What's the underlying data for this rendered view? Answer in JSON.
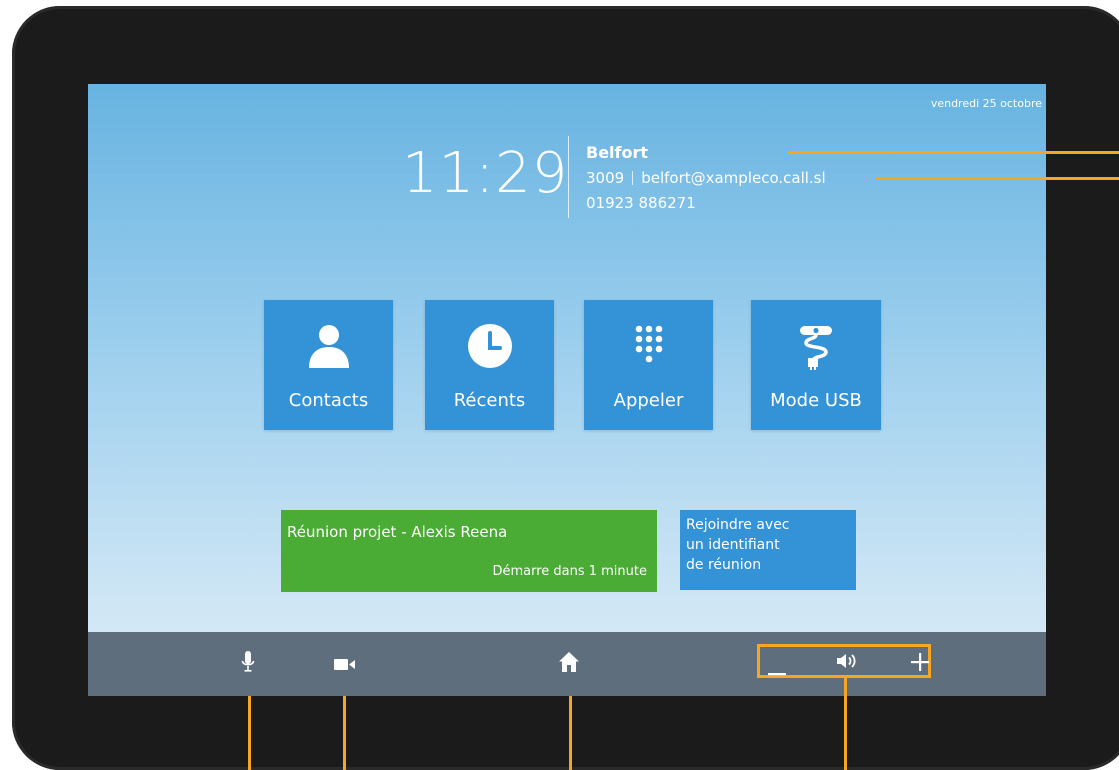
{
  "status": {
    "date": "vendredi 25 octobre",
    "time": "11:29"
  },
  "device_info": {
    "name": "Belfort",
    "extension": "3009",
    "email": "belfort@xampleco.call.sl",
    "phone": "01923 886271"
  },
  "tiles": [
    {
      "label": "Contacts",
      "icon": "person-icon"
    },
    {
      "label": "Récents",
      "icon": "clock-icon"
    },
    {
      "label": "Appeler",
      "icon": "keypad-icon"
    },
    {
      "label": "Mode USB",
      "icon": "usb-camera-icon"
    }
  ],
  "meeting": {
    "title": "Réunion projet - Alexis Reena",
    "status": "Démarre dans 1 minute"
  },
  "join": {
    "label": "Rejoindre avec\nun identifiant\nde réunion"
  },
  "bottom_bar": {
    "icons": [
      "microphone-icon",
      "camera-icon",
      "home-icon",
      "volume-down-icon",
      "speaker-icon",
      "volume-up-icon"
    ]
  },
  "colors": {
    "tile": "#3493d6",
    "meeting": "#4aab35",
    "bar": "#5f6e7c",
    "callout": "#f5a623"
  }
}
